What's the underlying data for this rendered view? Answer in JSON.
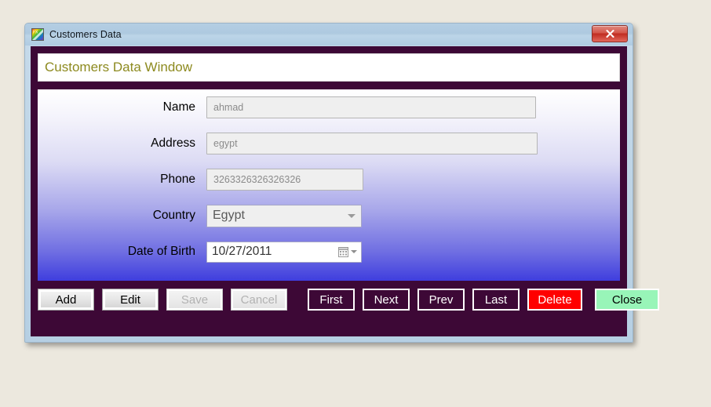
{
  "window": {
    "title": "Customers Data",
    "icon": "app-logo-icon",
    "close_label": "x"
  },
  "header": {
    "title": "Customers Data Window",
    "text_color": "#8d8a1f"
  },
  "form": {
    "fields": [
      {
        "label": "Name",
        "value": "ahmad",
        "type": "text"
      },
      {
        "label": "Address",
        "value": "egypt",
        "type": "text"
      },
      {
        "label": "Phone",
        "value": "3263326326326326",
        "type": "text"
      },
      {
        "label": "Country",
        "value": "Egypt",
        "type": "select"
      },
      {
        "label": "Date of Birth",
        "value": "10/27/2011",
        "type": "date"
      }
    ]
  },
  "buttons": [
    {
      "label": "Add",
      "state": "enabled",
      "style": "3d"
    },
    {
      "label": "Edit",
      "state": "enabled",
      "style": "3d"
    },
    {
      "label": "Save",
      "state": "disabled",
      "style": "disabled"
    },
    {
      "label": "Cancel",
      "state": "disabled",
      "style": "disabled"
    },
    {
      "label": "First",
      "state": "enabled",
      "style": "nav"
    },
    {
      "label": "Next",
      "state": "enabled",
      "style": "nav"
    },
    {
      "label": "Prev",
      "state": "enabled",
      "style": "nav"
    },
    {
      "label": "Last",
      "state": "enabled",
      "style": "nav"
    },
    {
      "label": "Delete",
      "state": "enabled",
      "style": "delete"
    },
    {
      "label": "Close",
      "state": "enabled",
      "style": "close"
    }
  ],
  "colors": {
    "frame_purple": "#3d0836",
    "delete_red": "#ff0000",
    "close_green": "#98f5b8",
    "desktop_beige": "#ece8de"
  }
}
